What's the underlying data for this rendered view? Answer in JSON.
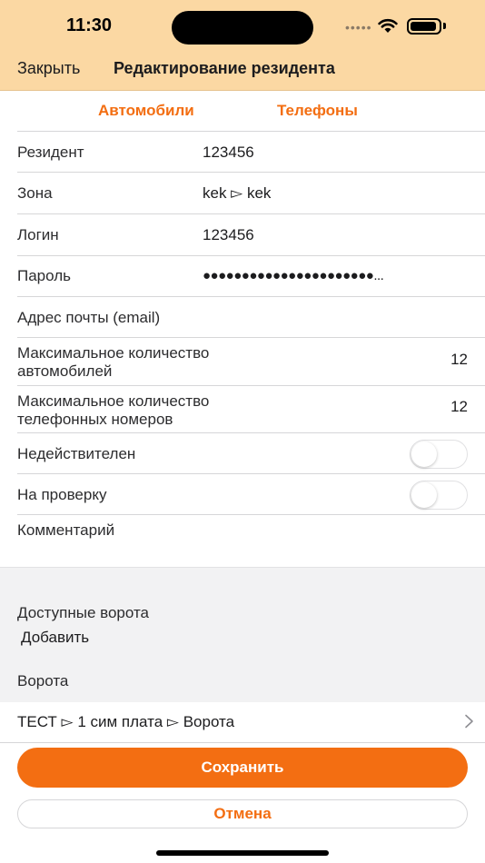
{
  "status": {
    "time": "11:30"
  },
  "nav": {
    "close_label": "Закрыть",
    "title": "Редактирование резидента"
  },
  "tabs": [
    {
      "label": "Автомобили"
    },
    {
      "label": "Телефоны"
    }
  ],
  "form": {
    "resident": {
      "label": "Резидент",
      "value": "123456"
    },
    "zone": {
      "label": "Зона",
      "value": "kek ▻ kek"
    },
    "login": {
      "label": "Логин",
      "value": "123456"
    },
    "password": {
      "label": "Пароль",
      "value": "●●●●●●●●●●●●●●●●●●●●●●..."
    },
    "email": {
      "label": "Адрес почты (email)",
      "value": ""
    },
    "max_cars": {
      "label_line1": "Максимальное количество",
      "label_line2": "автомобилей",
      "value": "12"
    },
    "max_phones": {
      "label_line1": "Максимальное количество",
      "label_line2": "телефонных номеров",
      "value": "12"
    },
    "invalid": {
      "label": "Недействителен",
      "on": false
    },
    "to_review": {
      "label": "На проверку",
      "on": false
    },
    "comment": {
      "label": "Комментарий",
      "value": ""
    }
  },
  "gates": {
    "section_title": "Доступные ворота",
    "add_label": "Добавить",
    "list_header": "Ворота",
    "items": [
      {
        "label": "ТЕСТ ▻ 1 сим плата ▻ Ворота"
      }
    ]
  },
  "actions": {
    "save_label": "Сохранить",
    "cancel_label": "Отмена"
  },
  "colors": {
    "accent": "#f36e12",
    "header_bg": "#fbd8a3"
  }
}
